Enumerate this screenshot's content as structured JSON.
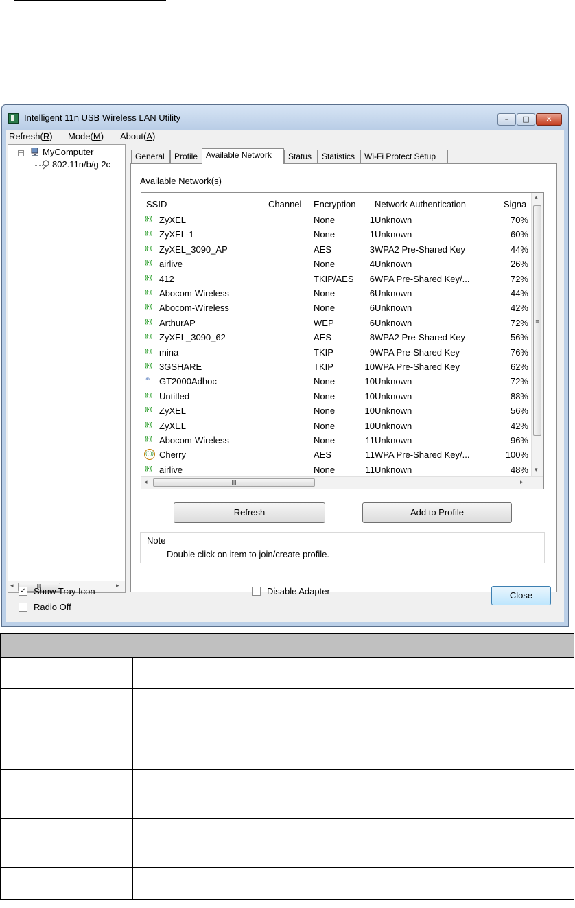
{
  "window": {
    "title": "Intelligent 11n USB Wireless LAN Utility",
    "buttons": {
      "minimize": "–",
      "maximize": "□",
      "close": "✕"
    }
  },
  "menu": [
    {
      "label": "Refresh(R)",
      "text": "Refresh(",
      "key": "R",
      "end": ")"
    },
    {
      "label": "Mode(M)",
      "text": "Mode(",
      "key": "M",
      "end": ")"
    },
    {
      "label": "About(A)",
      "text": "About(",
      "key": "A",
      "end": ")"
    }
  ],
  "tree": {
    "root": "MyComputer",
    "child": "802.11n/b/g 2c",
    "expander": "−"
  },
  "tabs": [
    "General",
    "Profile",
    "Available Network",
    "Status",
    "Statistics",
    "Wi-Fi Protect Setup"
  ],
  "active_tab": "Available Network",
  "panel": {
    "caption": "Available Network(s)",
    "columns": [
      "SSID",
      "Channel",
      "Encryption",
      "Network Authentication",
      "Signa"
    ],
    "rows": [
      {
        "icon": "wifi",
        "ssid": "ZyXEL",
        "channel": "1",
        "enc": "None",
        "auth": "Unknown",
        "signal": "70%"
      },
      {
        "icon": "wifi",
        "ssid": "ZyXEL-1",
        "channel": "1",
        "enc": "None",
        "auth": "Unknown",
        "signal": "60%"
      },
      {
        "icon": "wifi",
        "ssid": "ZyXEL_3090_AP",
        "channel": "3",
        "enc": "AES",
        "auth": "WPA2 Pre-Shared Key",
        "signal": "44%"
      },
      {
        "icon": "wifi",
        "ssid": "airlive",
        "channel": "4",
        "enc": "None",
        "auth": "Unknown",
        "signal": "26%"
      },
      {
        "icon": "wifi",
        "ssid": "412",
        "channel": "6",
        "enc": "TKIP/AES",
        "auth": "WPA Pre-Shared Key/...",
        "signal": "72%"
      },
      {
        "icon": "wifi",
        "ssid": "Abocom-Wireless",
        "channel": "6",
        "enc": "None",
        "auth": "Unknown",
        "signal": "44%"
      },
      {
        "icon": "wifi",
        "ssid": "Abocom-Wireless",
        "channel": "6",
        "enc": "None",
        "auth": "Unknown",
        "signal": "42%"
      },
      {
        "icon": "wifi",
        "ssid": "ArthurAP",
        "channel": "6",
        "enc": "WEP",
        "auth": "Unknown",
        "signal": "72%"
      },
      {
        "icon": "wifi",
        "ssid": "ZyXEL_3090_62",
        "channel": "8",
        "enc": "AES",
        "auth": "WPA2 Pre-Shared Key",
        "signal": "56%"
      },
      {
        "icon": "wifi",
        "ssid": "mina",
        "channel": "9",
        "enc": "TKIP",
        "auth": "WPA Pre-Shared Key",
        "signal": "76%"
      },
      {
        "icon": "wifi",
        "ssid": "3GSHARE",
        "channel": "10",
        "enc": "TKIP",
        "auth": "WPA Pre-Shared Key",
        "signal": "62%"
      },
      {
        "icon": "adhoc",
        "ssid": "GT2000Adhoc",
        "channel": "10",
        "enc": "None",
        "auth": "Unknown",
        "signal": "72%"
      },
      {
        "icon": "wifi",
        "ssid": "Untitled",
        "channel": "10",
        "enc": "None",
        "auth": "Unknown",
        "signal": "88%"
      },
      {
        "icon": "wifi",
        "ssid": "ZyXEL",
        "channel": "10",
        "enc": "None",
        "auth": "Unknown",
        "signal": "56%"
      },
      {
        "icon": "wifi",
        "ssid": "ZyXEL",
        "channel": "10",
        "enc": "None",
        "auth": "Unknown",
        "signal": "42%"
      },
      {
        "icon": "wifi",
        "ssid": "Abocom-Wireless",
        "channel": "11",
        "enc": "None",
        "auth": "Unknown",
        "signal": "96%"
      },
      {
        "icon": "locked",
        "ssid": "Cherry",
        "channel": "11",
        "enc": "AES",
        "auth": "WPA Pre-Shared Key/...",
        "signal": "100%"
      },
      {
        "icon": "wifi",
        "ssid": "airlive",
        "channel": "11",
        "enc": "None",
        "auth": "Unknown",
        "signal": "48%"
      }
    ],
    "refresh_button": "Refresh",
    "add_profile_button": "Add to Profile",
    "note_title": "Note",
    "note_text": "Double click on item to join/create profile."
  },
  "footer": {
    "show_tray_icon": {
      "label": "Show Tray Icon",
      "checked": true
    },
    "radio_off": {
      "label": "Radio Off",
      "checked": false
    },
    "disable_adapter": {
      "label": "Disable Adapter",
      "checked": false
    },
    "close_button": "Close"
  },
  "doc_table": {
    "rows": 6
  }
}
